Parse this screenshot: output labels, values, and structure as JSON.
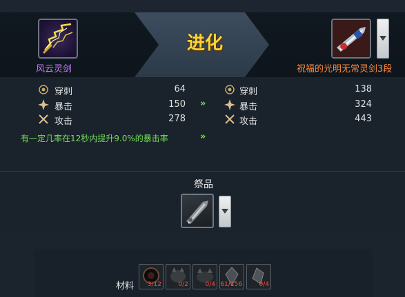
{
  "header": {
    "title": "进化",
    "left_item": {
      "name": "风云灵剑",
      "icon": "lightning-sword-icon"
    },
    "right_item": {
      "name": "祝福的光明无常灵剑3段",
      "icon": "blessed-blade-icon"
    }
  },
  "stats_before": [
    {
      "icon": "pierce-icon",
      "label": "穿刺",
      "value": "64"
    },
    {
      "icon": "critical-icon",
      "label": "暴击",
      "value": "150"
    },
    {
      "icon": "attack-icon",
      "label": "攻击",
      "value": "278"
    }
  ],
  "stats_after": [
    {
      "icon": "pierce-icon",
      "label": "穿刺",
      "value": "138"
    },
    {
      "icon": "critical-icon",
      "label": "暴击",
      "value": "324"
    },
    {
      "icon": "attack-icon",
      "label": "攻击",
      "value": "443"
    }
  ],
  "arrow_text": "»",
  "effect_text": "有一定几率在12秒内提升9.0%的暴击率",
  "sacrifice": {
    "label": "祭品"
  },
  "materials": {
    "label": "材料",
    "slots": [
      {
        "icon": "dark-orb-icon",
        "count": "3/12"
      },
      {
        "icon": "beast-head-icon",
        "count": "0/2"
      },
      {
        "icon": "beast-head-icon",
        "count": "0/4"
      },
      {
        "icon": "crystal-icon",
        "count": "61/156"
      },
      {
        "icon": "crystal-icon",
        "count": "0/4"
      }
    ]
  },
  "colors": {
    "title": "#ffd23c",
    "left_name": "#c77dff",
    "right_name": "#ff8a3c",
    "effect": "#74e05a",
    "material_count": "#ff4a3c"
  }
}
